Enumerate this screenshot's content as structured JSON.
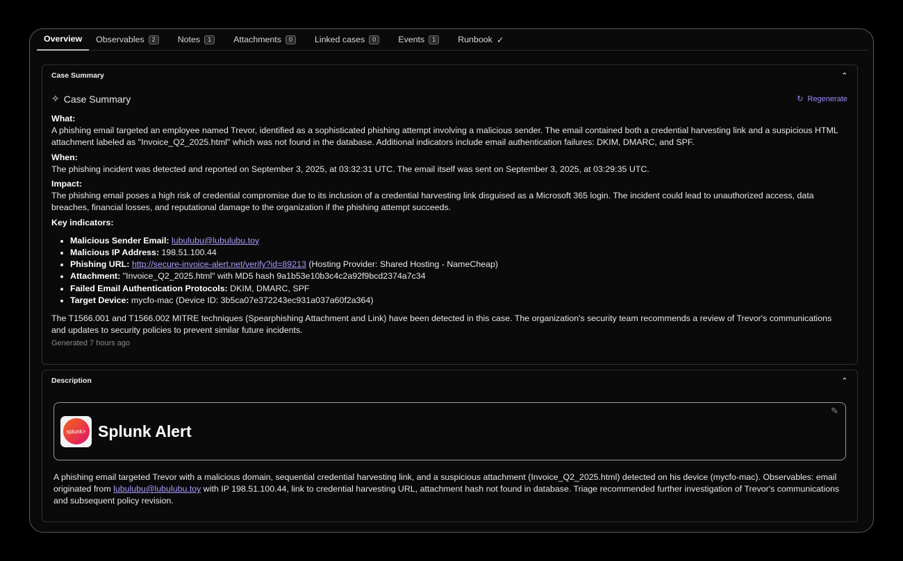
{
  "tabs": [
    {
      "label": "Overview"
    },
    {
      "label": "Observables",
      "count": "2"
    },
    {
      "label": "Notes",
      "count": "1"
    },
    {
      "label": "Attachments",
      "count": "0"
    },
    {
      "label": "Linked cases",
      "count": "0"
    },
    {
      "label": "Events",
      "count": "1"
    },
    {
      "label": "Runbook",
      "icon": "check-icon"
    }
  ],
  "summary": {
    "header": "Case Summary",
    "title": "Case Summary",
    "regenerate": "Regenerate",
    "what_label": "What:",
    "what": "A phishing email targeted an employee named Trevor, identified as a sophisticated phishing attempt involving a malicious sender. The email contained both a credential harvesting link and a suspicious HTML attachment labeled as \"Invoice_Q2_2025.html\" which was not found in the database. Additional indicators include email authentication failures: DKIM, DMARC, and SPF.",
    "when_label": "When:",
    "when": "The phishing incident was detected and reported on September 3, 2025, at 03:32:31 UTC. The email itself was sent on September 3, 2025, at 03:29:35 UTC.",
    "impact_label": "Impact:",
    "impact": "The phishing email poses a high risk of credential compromise due to its inclusion of a credential harvesting link disguised as a Microsoft 365 login. The incident could lead to unauthorized access, data breaches, financial losses, and reputational damage to the organization if the phishing attempt succeeds.",
    "key_label": "Key indicators:",
    "indicators": [
      {
        "label": "Malicious Sender Email:",
        "link": "lubulubu@lubulubu.toy",
        "text": ""
      },
      {
        "label": "Malicious IP Address:",
        "link": "",
        "text": " 198.51.100.44"
      },
      {
        "label": "Phishing URL:",
        "link": "http://secure-invoice-alert.net/verify?id=89213",
        "text": " (Hosting Provider: Shared Hosting - NameCheap)"
      },
      {
        "label": "Attachment:",
        "link": "",
        "text": " \"Invoice_Q2_2025.html\" with MD5 hash 9a1b53e10b3c4c2a92f9bcd2374a7c34"
      },
      {
        "label": "Failed Email Authentication Protocols:",
        "link": "",
        "text": " DKIM, DMARC, SPF"
      },
      {
        "label": "Target Device:",
        "link": "",
        "text": " mycfo-mac (Device ID: 3b5ca07e372243ec931a037a60f2a364)"
      }
    ],
    "conclusion": "The T1566.001 and T1566.002 MITRE techniques (Spearphishing Attachment and Link) have been detected in this case. The organization's security team recommends a review of Trevor's communications and updates to security policies to prevent similar future incidents.",
    "generated": "Generated 7 hours ago"
  },
  "description": {
    "header": "Description",
    "logo_text": "splunk>",
    "alert_title": "Splunk Alert",
    "text1": "A phishing email targeted Trevor with a malicious domain, sequential credential harvesting link, and a suspicious attachment (Invoice_Q2_2025.html) detected on his device (mycfo-mac). Observables: email originated from ",
    "link": "lubulubu@lubulubu.toy",
    "text2": " with IP 198.51.100.44, link to credential harvesting URL, attachment hash not found in database. Triage recommended further investigation of Trevor's communications and subsequent policy revision."
  }
}
